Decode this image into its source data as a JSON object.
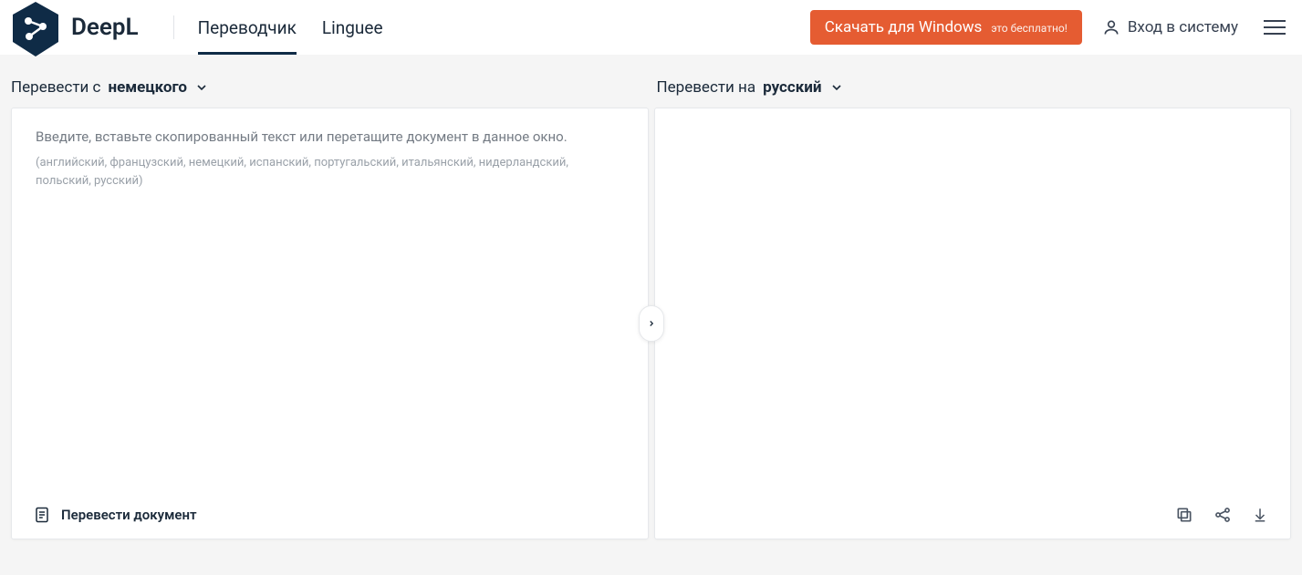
{
  "header": {
    "brand": "DeepL",
    "nav": {
      "translator": "Переводчик",
      "linguee": "Linguee"
    },
    "download": {
      "label": "Скачать для Windows",
      "badge": "это бесплатно!"
    },
    "login": "Вход в систему"
  },
  "source": {
    "prefix": "Перевести с ",
    "language": "немецкого",
    "placeholder": "Введите, вставьте скопированный текст или перетащите документ в данное окно.",
    "languages_hint": "(английский, французский, немецкий, испанский, португальский, итальянский, нидерландский, польский, русский)",
    "translate_document": "Перевести документ"
  },
  "target": {
    "prefix": "Перевести на ",
    "language": "русский"
  }
}
